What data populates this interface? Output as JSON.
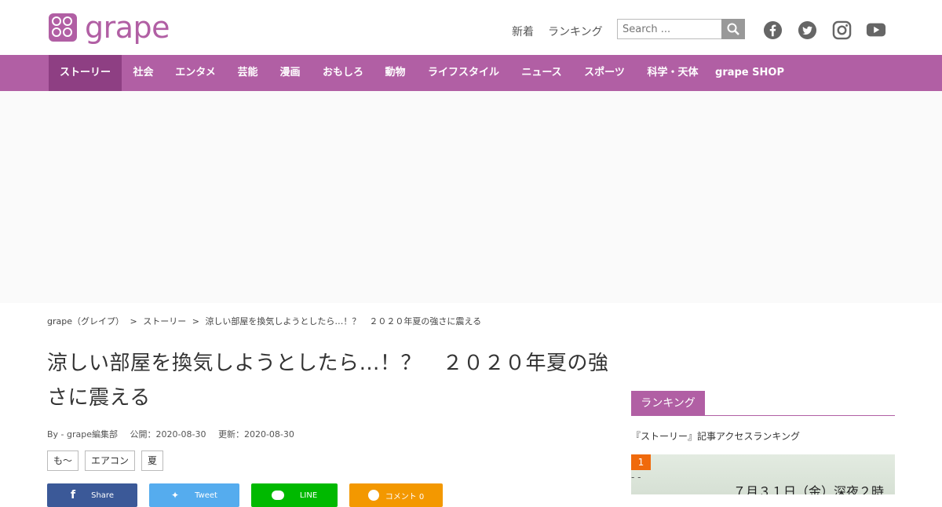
{
  "header": {
    "logo_text": "grape",
    "links": [
      "新着",
      "ランキング"
    ],
    "search_placeholder": "Search ...",
    "social": [
      "facebook-icon",
      "twitter-icon",
      "instagram-icon",
      "youtube-icon"
    ]
  },
  "nav": {
    "items": [
      "ストーリー",
      "社会",
      "エンタメ",
      "芸能",
      "漫画",
      "おもしろ",
      "動物",
      "ライフスタイル",
      "ニュース",
      "スポーツ",
      "科学・天体",
      "grape SHOP"
    ],
    "active_index": 0
  },
  "breadcrumb": {
    "home": "grape（グレイプ）",
    "sep": ">",
    "category": "ストーリー",
    "current": "涼しい部屋を換気しようとしたら…！？　２０２０年夏の強さに震える"
  },
  "article": {
    "title": "涼しい部屋を換気しようとしたら…！？　２０２０年夏の強さに震える",
    "author": "By - grape編集部",
    "published": "公開：2020-08-30",
    "updated": "更新：2020-08-30",
    "tags": [
      "も～",
      "エアコン",
      "夏"
    ],
    "share": [
      {
        "label": "Share",
        "color": "#3b5998"
      },
      {
        "label": "Tweet",
        "color": "#55acee"
      },
      {
        "label": "LINE",
        "color": "#00b900"
      },
      {
        "label": "コメント 0",
        "color": "#f39800"
      }
    ]
  },
  "sidebar": {
    "ranking_heading": "ランキング",
    "ranking_sub": "『ストーリー』記事アクセスランキング",
    "first_rank": "1",
    "first_image_text": "７月３１日（金）深夜２時"
  },
  "colors": {
    "brand": "#b15fa4",
    "brand_dark": "#8e3f83",
    "rank_badge": "#f06a0c"
  }
}
